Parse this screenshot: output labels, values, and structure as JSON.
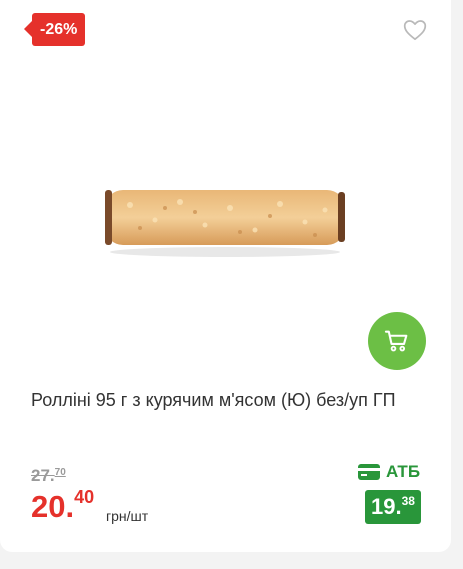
{
  "product": {
    "discount_badge": "-26%",
    "title": "Ролліні 95 г з курячим м'ясом (Ю) без/уп ГП",
    "old_price": {
      "int": "27.",
      "cents": "70"
    },
    "price": {
      "int": "20",
      "dot": ".",
      "cents": "40"
    },
    "unit": "грн/шт",
    "loyalty": {
      "label": "АТБ",
      "price": {
        "int": "19.",
        "cents": "38"
      }
    }
  },
  "icons": {
    "favorite": "heart-icon",
    "cart": "cart-icon",
    "loyalty": "card-icon"
  },
  "colors": {
    "discount": "#e5312b",
    "cart_button": "#6cbf45",
    "loyalty": "#29963a",
    "old_price": "#9a9a9a"
  }
}
